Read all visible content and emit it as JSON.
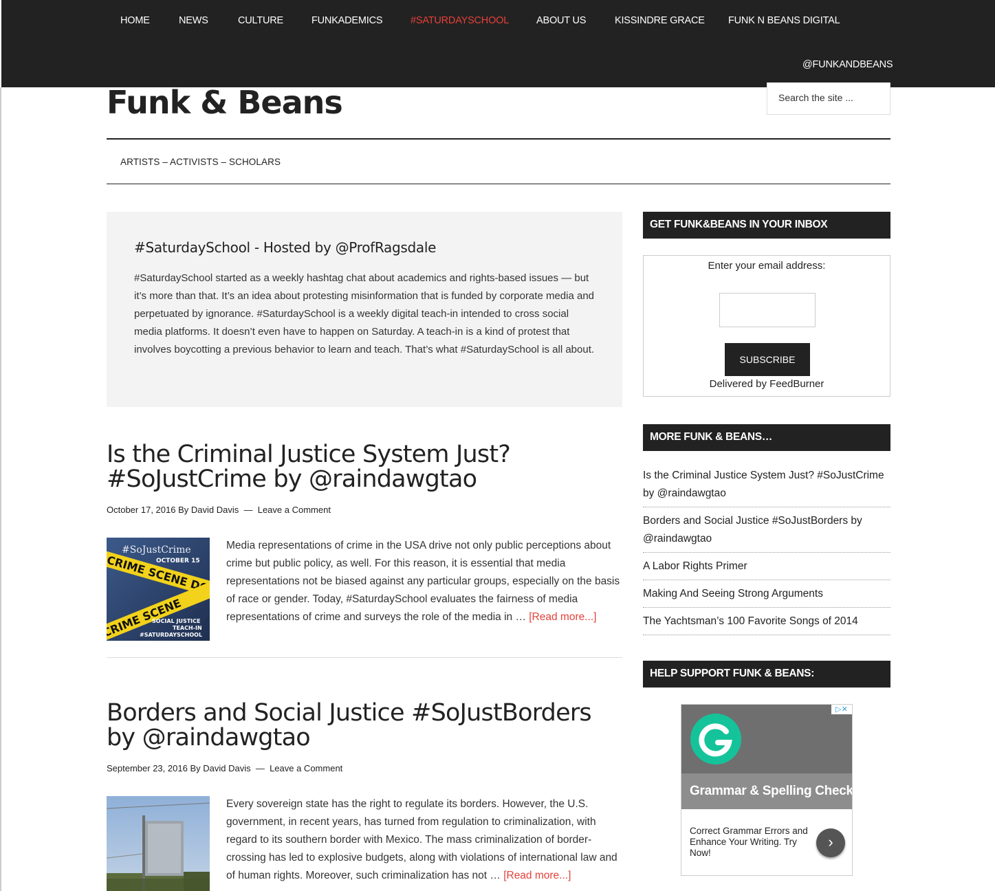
{
  "topnav": {
    "items": [
      {
        "label": "HOME",
        "active": false
      },
      {
        "label": "NEWS",
        "active": false
      },
      {
        "label": "CULTURE",
        "active": false
      },
      {
        "label": "FUNKADEMICS",
        "active": false
      },
      {
        "label": "#SATURDAYSCHOOL",
        "active": true
      },
      {
        "label": "ABOUT US",
        "active": false
      },
      {
        "label": "KISSINDRE GRACE",
        "active": false
      },
      {
        "label": "FUNK N BEANS DIGITAL",
        "active": false
      },
      {
        "label": "@FUNKANDBEANS",
        "active": false
      }
    ]
  },
  "header": {
    "site_title": "Funk & Beans",
    "search_placeholder": "Search the site ..."
  },
  "subnav": {
    "item": "ARTISTS – ACTIVISTS – SCHOLARS"
  },
  "intro": {
    "title": "#SaturdaySchool - Hosted by @ProfRagsdale",
    "text": "#SaturdaySchool started as a weekly hashtag chat about academics and rights-based issues — but it’s more than that. It’s an idea about protesting misinformation that is funded by corporate media and perpetuated by ignorance. #SaturdaySchool is a weekly digital teach-in intended to cross social media platforms. It doesn’t even have to happen on Saturday. A teach-in is a kind of protest that involves boycotting a previous behavior to learn and teach. That’s what #SaturdaySchool is all about."
  },
  "posts": [
    {
      "title": "Is the Criminal Justice System Just? #SoJustCrime by @raindawgtao",
      "date": "October 17, 2016",
      "by": "By",
      "author": "David Davis",
      "sep": "—",
      "comment": "Leave a Comment",
      "excerpt": "Media representations of crime in the USA drive not only public perceptions about crime but public policy, as well. For this reason, it is essential that media representations not be biased against any particular groups, especially on the basis of race or gender. Today, #SaturdaySchool evaluates the fairness of media representations of crime and surveys the role of the media in … ",
      "read_more": "[Read more...]",
      "thumb": {
        "tag": "#SoJustCrime",
        "date": "OCTOBER 15",
        "tape1": "CRIME SCENE DO",
        "tape2": "CRIME SCENE",
        "line1": "SOCIAL JUSTICE",
        "line2": "TEACH-IN",
        "line3": "#SATURDAYSCHOOL"
      }
    },
    {
      "title": "Borders and Social Justice #SoJustBorders by @raindawgtao",
      "date": "September 23, 2016",
      "by": "By",
      "author": "David Davis",
      "sep": "—",
      "comment": "Leave a Comment",
      "excerpt": "Every sovereign state has the right to regulate its borders. However, the U.S. government, in recent years, has turned from regulation to criminalization, with regard to its southern border with Mexico. The mass criminalization of border-crossing has led to explosive budgets, along with violations of international law and of human rights. Moreover, such criminalization has not … ",
      "read_more": "[Read more...]"
    }
  ],
  "sidebar": {
    "inbox_title": "GET FUNK&BEANS IN YOUR INBOX",
    "email_label": "Enter your email address:",
    "subscribe_label": "SUBSCRIBE",
    "delivered_prefix": "Delivered by ",
    "delivered_brand": "FeedBurner",
    "more_title": "MORE FUNK & BEANS…",
    "more_items": [
      "Is the Criminal Justice System Just? #SoJustCrime by @raindawgtao",
      "Borders and Social Justice #SoJustBorders by @raindawgtao",
      "A Labor Rights Primer",
      "Making And Seeing Strong Arguments",
      "The Yachtsman’s 100 Favorite Songs of 2014"
    ],
    "support_title": "HELP SUPPORT FUNK & BEANS:",
    "ad": {
      "headline": "Grammar & Spelling Check",
      "body": "Correct Grammar Errors and Enhance Your Writing. Try Now!",
      "choices": "▷✕"
    }
  },
  "colors": {
    "nav_bg": "#222222",
    "accent": "#e5413a",
    "ad_green": "#15c39a"
  }
}
